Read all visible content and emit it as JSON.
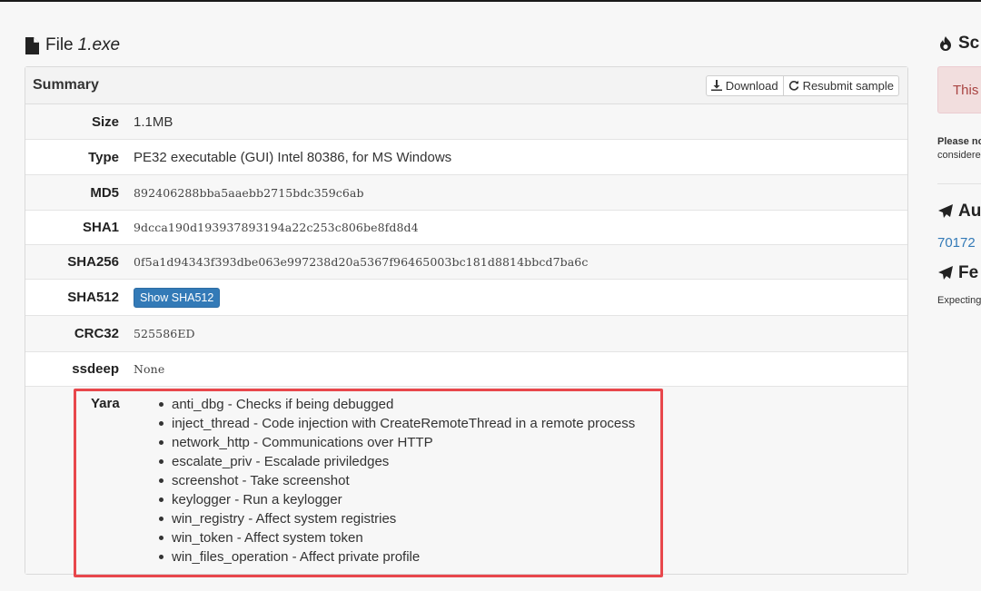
{
  "page": {
    "title_prefix": "File",
    "file_name": "1.exe"
  },
  "summary": {
    "heading": "Summary",
    "download_label": "Download",
    "resubmit_label": "Resubmit sample",
    "rows": {
      "size": {
        "key": "Size",
        "value": "1.1MB"
      },
      "type": {
        "key": "Type",
        "value": "PE32 executable (GUI) Intel 80386, for MS Windows"
      },
      "md5": {
        "key": "MD5",
        "value": "892406288bba5aaebb2715bdc359c6ab"
      },
      "sha1": {
        "key": "SHA1",
        "value": "9dcca190d193937893194a22c253c806be8fd8d4"
      },
      "sha256": {
        "key": "SHA256",
        "value": "0f5a1d94343f393dbe063e997238d20a5367f96465003bc181d8814bbcd7ba6c"
      },
      "sha512": {
        "key": "SHA512",
        "button": "Show SHA512"
      },
      "crc32": {
        "key": "CRC32",
        "value": "525586ED"
      },
      "ssdeep": {
        "key": "ssdeep",
        "value": "None"
      }
    },
    "yara": {
      "key": "Yara",
      "items": [
        "anti_dbg - Checks if being debugged",
        "inject_thread - Code injection with CreateRemoteThread in a remote process",
        "network_http - Communications over HTTP",
        "escalate_priv - Escalade priviledges",
        "screenshot - Take screenshot",
        "keylogger - Run a keylogger",
        "win_registry - Affect system registries",
        "win_token - Affect system token",
        "win_files_operation - Affect private profile"
      ]
    }
  },
  "sidebar": {
    "score_heading": "Sc",
    "alert_text": "This",
    "note_bold": "Please no",
    "note_text": "considere",
    "author_heading": "Au",
    "author_link": "70172",
    "feedback_heading": "Fe",
    "feedback_text": "Expecting"
  },
  "colors": {
    "highlight": "#e8474c",
    "primary_button": "#337ab7",
    "alert_bg": "#f2dede",
    "alert_text": "#a94442"
  },
  "icons": [
    "file-icon",
    "download-icon",
    "refresh-icon",
    "fire-icon",
    "paper-plane-icon"
  ]
}
